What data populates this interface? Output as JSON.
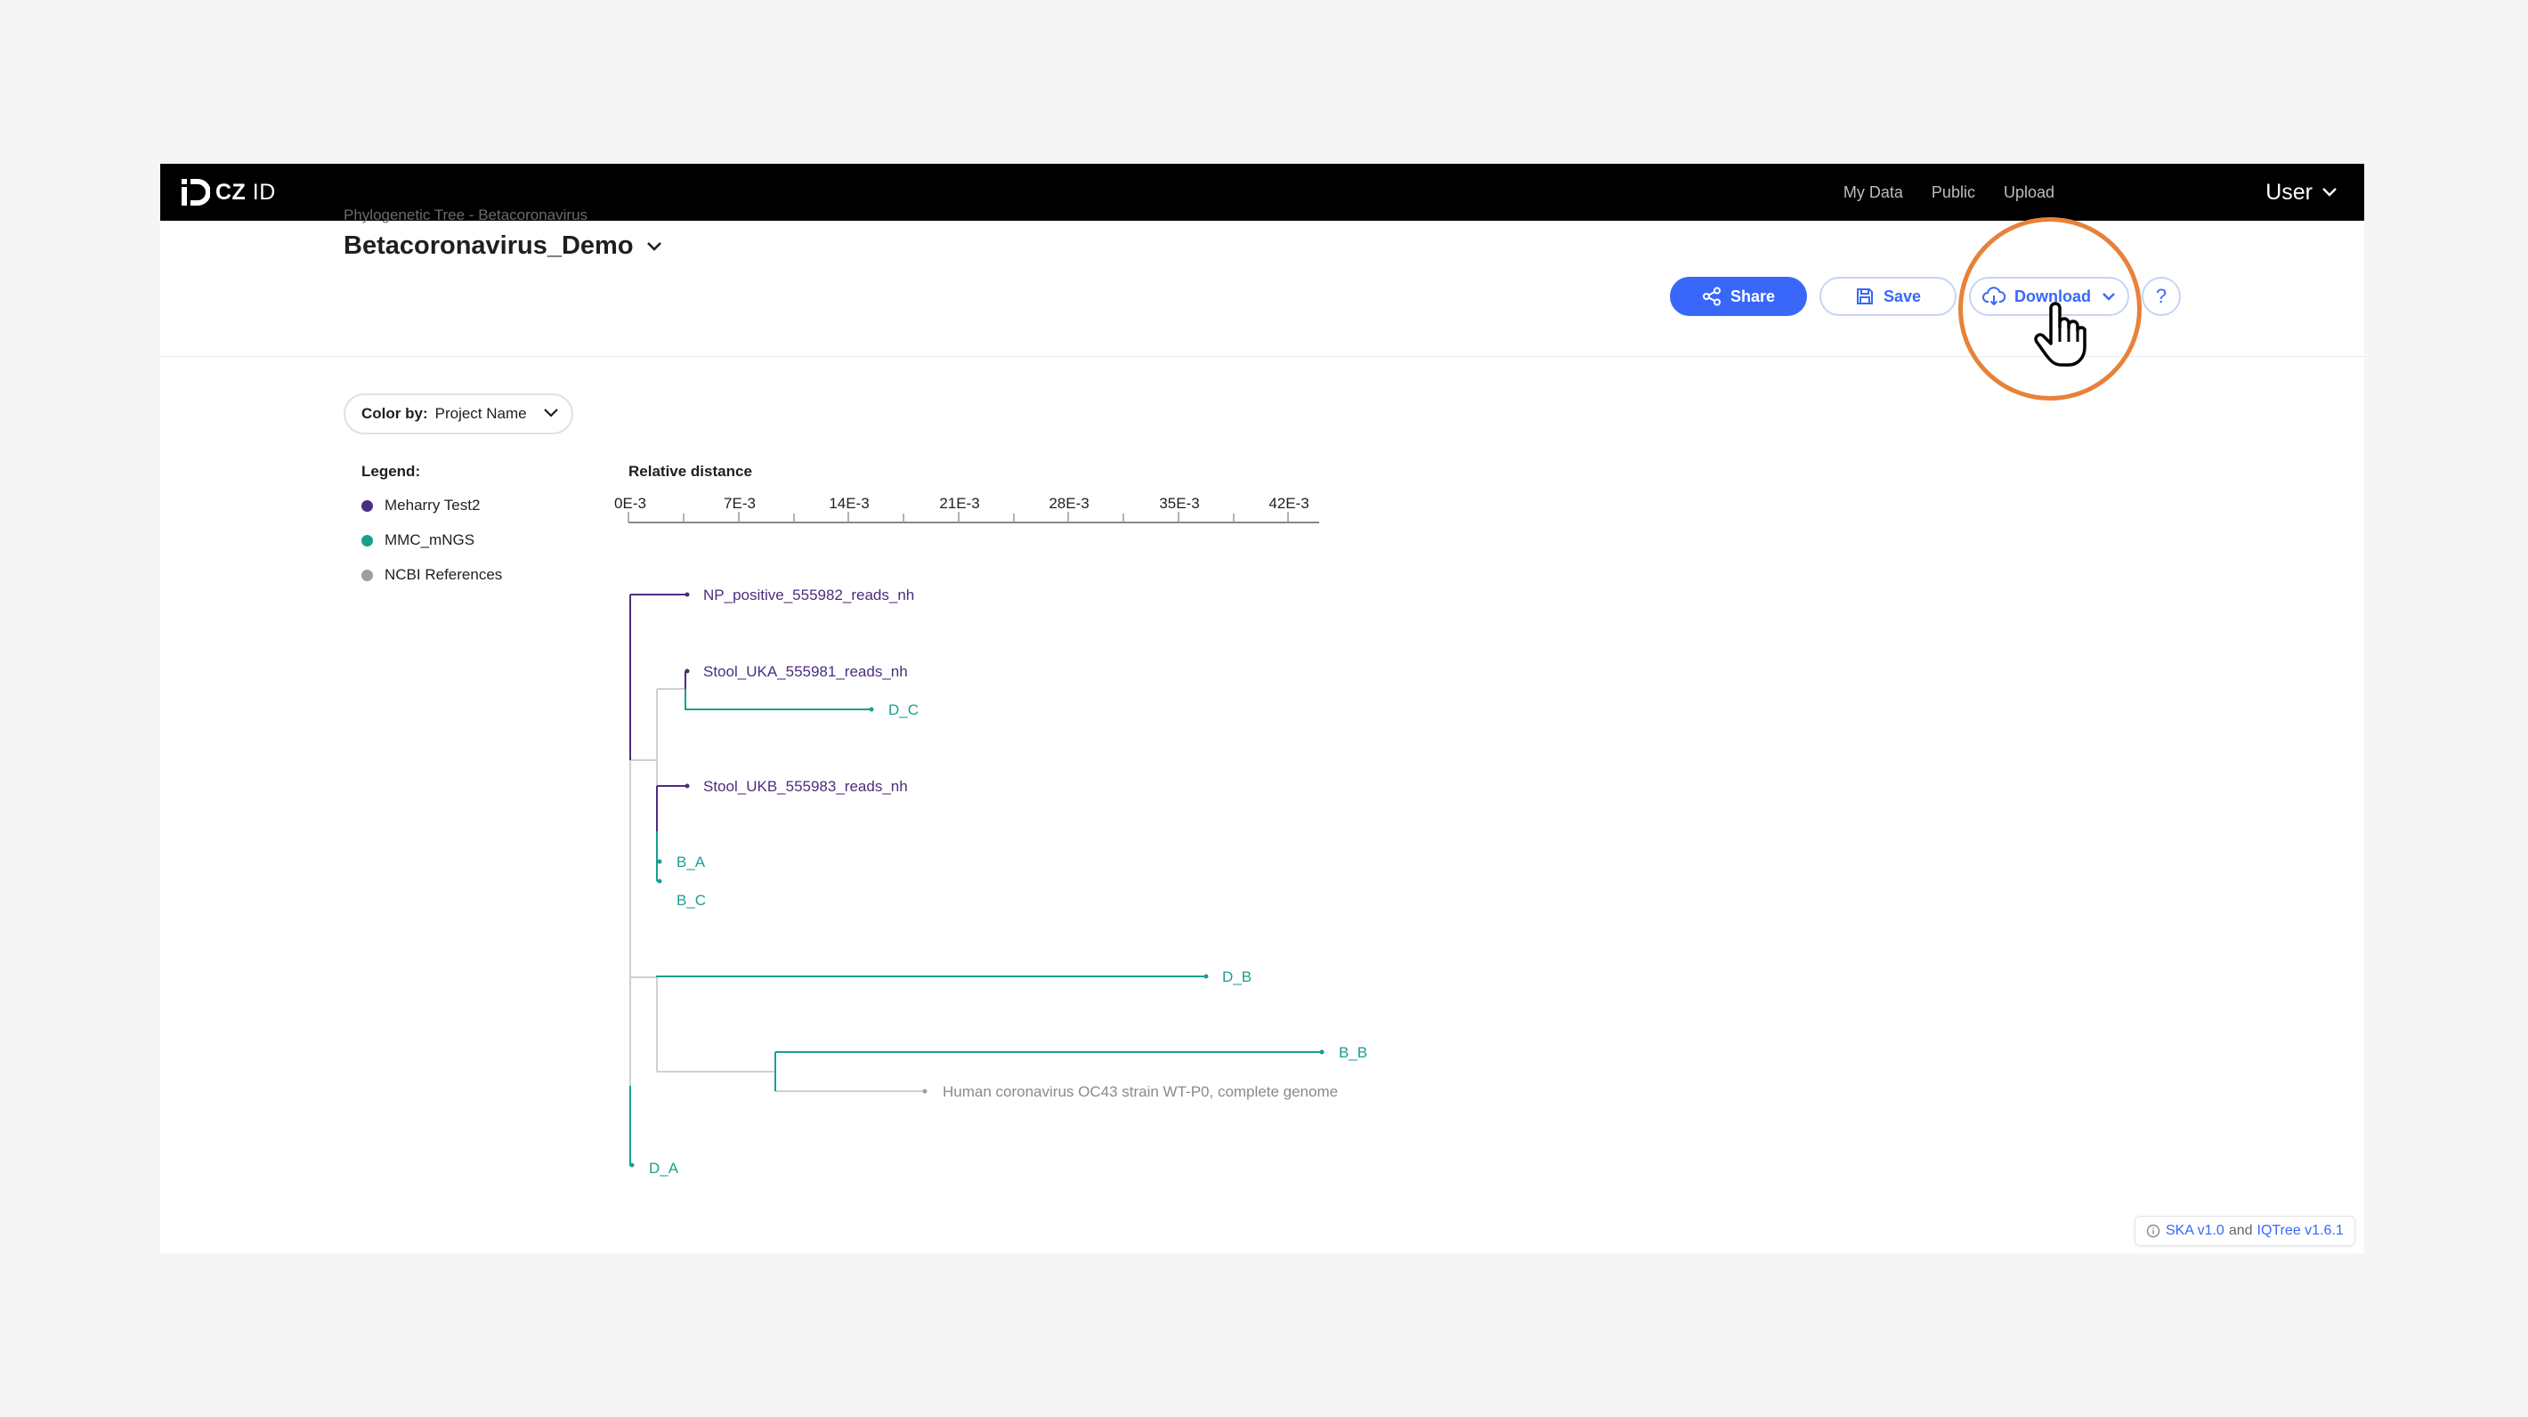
{
  "nav": {
    "logo_bold": "CZ",
    "logo_light": "ID",
    "links": [
      "My Data",
      "Public",
      "Upload"
    ],
    "user": "User"
  },
  "header": {
    "breadcrumb": "Phylogenetic Tree - Betacoronavirus",
    "title": "Betacoronavirus_Demo",
    "share_label": "Share",
    "save_label": "Save",
    "download_label": "Download",
    "help_label": "?"
  },
  "color_by": {
    "label": "Color by:",
    "value": "Project Name"
  },
  "legend": {
    "title": "Legend:",
    "items": [
      {
        "label": "Meharry Test2",
        "color": "#4b2d7f"
      },
      {
        "label": "MMC_mNGS",
        "color": "#1a9e8f"
      },
      {
        "label": "NCBI References",
        "color": "#9e9e9e"
      }
    ]
  },
  "tree": {
    "axis_title": "Relative distance",
    "ticks": [
      "0E-3",
      "7E-3",
      "14E-3",
      "21E-3",
      "28E-3",
      "35E-3",
      "42E-3"
    ],
    "leaves": [
      {
        "label": "NP_positive_555982_reads_nh",
        "group": "Meharry Test2"
      },
      {
        "label": "Stool_UKA_555981_reads_nh",
        "group": "Meharry Test2"
      },
      {
        "label": "D_C",
        "group": "MMC_mNGS"
      },
      {
        "label": "Stool_UKB_555983_reads_nh",
        "group": "Meharry Test2"
      },
      {
        "label": "B_A",
        "group": "MMC_mNGS"
      },
      {
        "label": "B_C",
        "group": "MMC_mNGS"
      },
      {
        "label": "D_B",
        "group": "MMC_mNGS"
      },
      {
        "label": "B_B",
        "group": "MMC_mNGS"
      },
      {
        "label": "Human coronavirus OC43 strain WT-P0, complete genome",
        "group": "NCBI References"
      },
      {
        "label": "D_A",
        "group": "MMC_mNGS"
      }
    ]
  },
  "footer": {
    "ska": "SKA v1.0",
    "and": "and",
    "iqtree": "IQTree v1.6.1"
  }
}
